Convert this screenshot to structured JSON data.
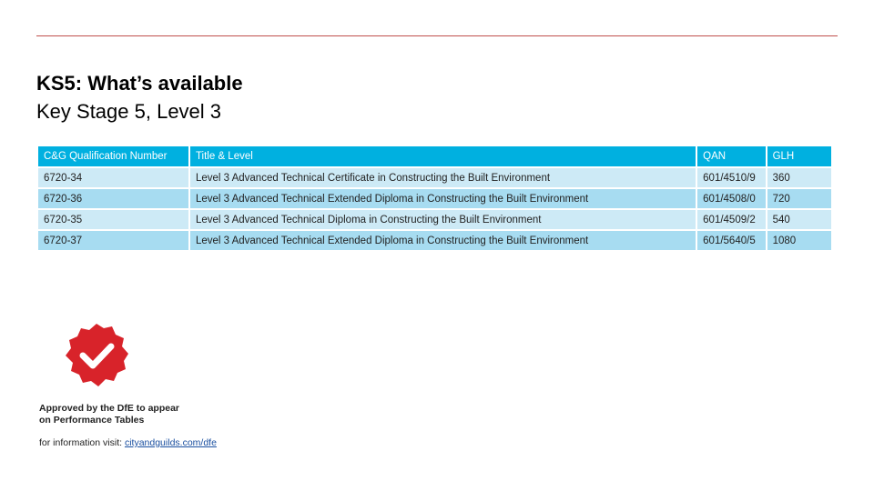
{
  "slide": {
    "title": "KS5: What’s available",
    "subtitle": "Key Stage 5, Level 3"
  },
  "table": {
    "headers": [
      "C&G Qualification Number",
      "Title & Level",
      "QAN",
      "GLH"
    ],
    "rows": [
      [
        "6720-34",
        "Level 3 Advanced Technical Certificate in Constructing the Built Environment",
        "601/4510/9",
        "360"
      ],
      [
        "6720-36",
        "Level 3 Advanced Technical Extended Diploma in Constructing the Built Environment",
        "601/4508/0",
        "720"
      ],
      [
        "6720-35",
        "Level 3 Advanced Technical Diploma in Constructing the Built Environment",
        "601/4509/2",
        "540"
      ],
      [
        "6720-37",
        "Level 3 Advanced Technical Extended Diploma in Constructing the Built Environment",
        "601/5640/5",
        "1080"
      ]
    ]
  },
  "badge": {
    "icon": "checkmark-seal-icon",
    "approval_line1": "Approved by the DfE to appear",
    "approval_line2": "on Performance Tables",
    "info_prefix": "for information visit:",
    "info_link": "cityandguilds.com/dfe"
  },
  "colors": {
    "rule": "#c0504d",
    "header_bg": "#00b0e0",
    "row_light": "#cdeaf6",
    "row_dark": "#a7dcf1",
    "seal": "#d8232a"
  }
}
